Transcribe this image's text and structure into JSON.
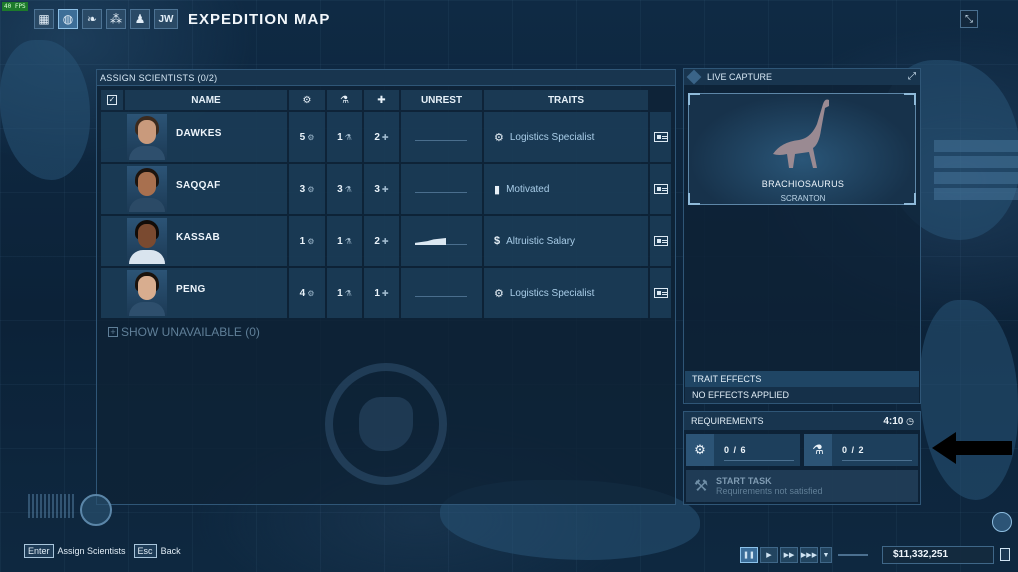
{
  "hud": {
    "fps": "40 FPS"
  },
  "topbar": {
    "buttons": [
      {
        "icon": "dashboard-icon",
        "glyph": "▦"
      },
      {
        "icon": "globe-icon",
        "glyph": "◍"
      },
      {
        "icon": "dinosaur-skeleton-icon",
        "glyph": "❧"
      },
      {
        "icon": "molecules-icon",
        "glyph": "⁂"
      },
      {
        "icon": "person-icon",
        "glyph": "♟"
      },
      {
        "icon": "jw-logo-icon",
        "glyph": "JW"
      }
    ],
    "title": "EXPEDITION MAP",
    "collapse_glyph": "⤡"
  },
  "scientists_panel": {
    "title": "ASSIGN SCIENTISTS",
    "count": "(0/2)",
    "columns": {
      "name": "NAME",
      "unrest": "UNREST",
      "traits": "TRAITS"
    },
    "rows": [
      {
        "name": "DAWKES",
        "gear": "5",
        "lab": "1",
        "plus": "2",
        "unrest": 0,
        "trait_icon": "gears-icon",
        "trait_glyph": "⚙",
        "trait": "Logistics Specialist",
        "skin": "#c99a7c",
        "hair": "#3b2a1e",
        "shirt": "#2e4f6d"
      },
      {
        "name": "SAQQAF",
        "gear": "3",
        "lab": "3",
        "plus": "3",
        "unrest": 0,
        "trait_icon": "battery-icon",
        "trait_glyph": "▮",
        "trait": "Motivated",
        "skin": "#a8704f",
        "hair": "#1d140e",
        "shirt": "#2b4a66"
      },
      {
        "name": "KASSAB",
        "gear": "1",
        "lab": "1",
        "plus": "2",
        "unrest": 0.6,
        "trait_icon": "salary-icon",
        "trait_glyph": "$",
        "trait": "Altruistic Salary",
        "skin": "#7a4a30",
        "hair": "#120c08",
        "shirt": "#d9e4ee"
      },
      {
        "name": "PENG",
        "gear": "4",
        "lab": "1",
        "plus": "1",
        "unrest": 0,
        "trait_icon": "gears-icon",
        "trait_glyph": "⚙",
        "trait": "Logistics Specialist",
        "skin": "#d8ad8f",
        "hair": "#1a120c",
        "shirt": "#2e4f6d"
      }
    ],
    "show_unavailable": "SHOW UNAVAILABLE (0)"
  },
  "live_capture": {
    "title": "LIVE CAPTURE",
    "dinosaur": "BRACHIOSAURUS",
    "location": "SCRANTON",
    "trait_effects_title": "TRAIT EFFECTS",
    "trait_effects_value": "NO EFFECTS APPLIED"
  },
  "requirements": {
    "title": "REQUIREMENTS",
    "time": "4:10",
    "gear_value": "0 / 6",
    "lab_value": "0 / 2",
    "start_task": "START TASK",
    "start_task_status": "Requirements not satisfied"
  },
  "bottom": {
    "enter_key": "Enter",
    "enter_label": "Assign Scientists",
    "esc_key": "Esc",
    "esc_label": "Back",
    "money": "$11,332,251"
  }
}
